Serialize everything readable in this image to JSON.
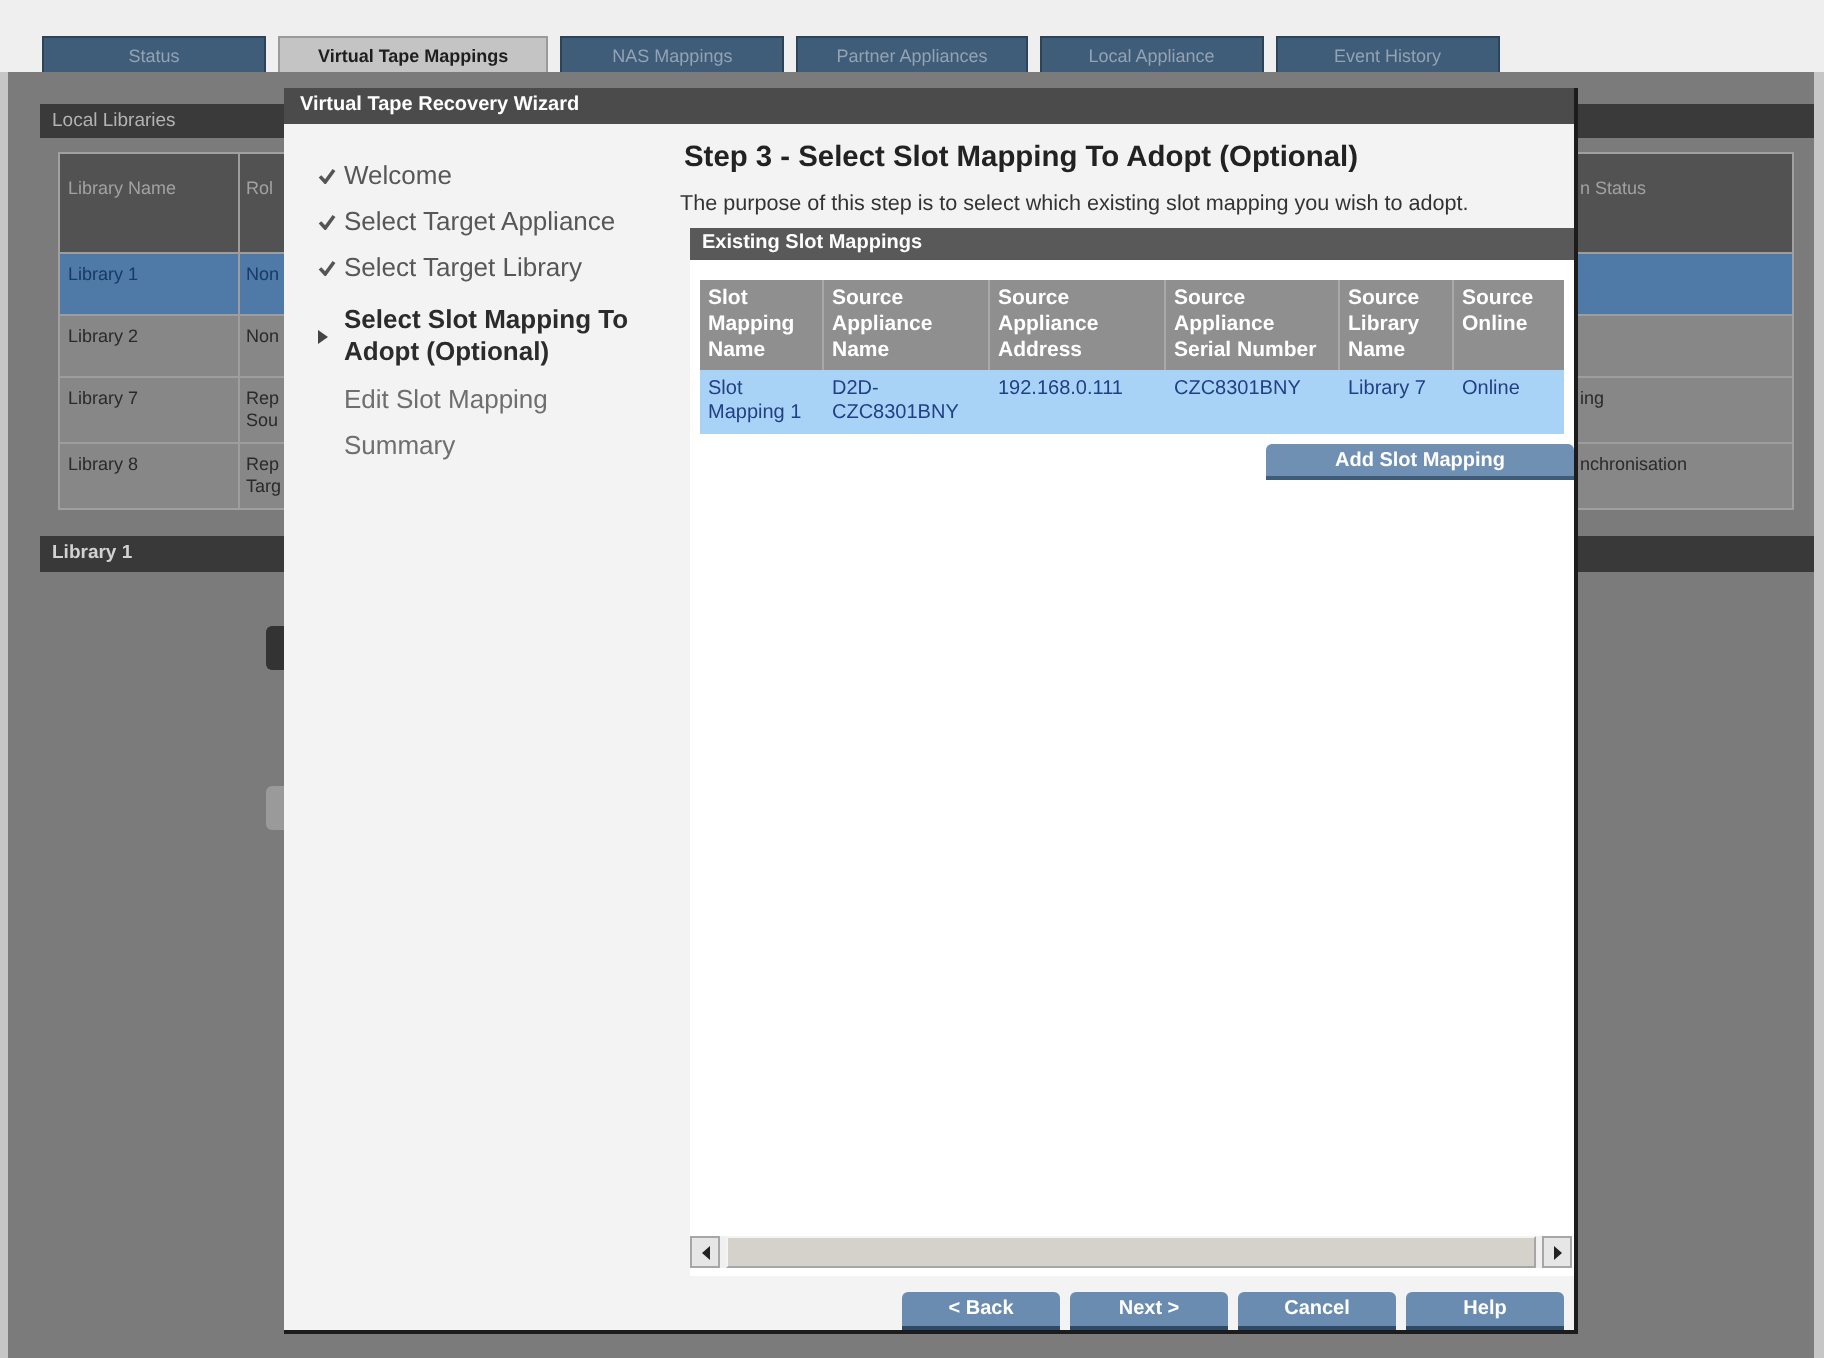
{
  "tabs": [
    {
      "label": "Status",
      "selected": false
    },
    {
      "label": "Virtual Tape Mappings",
      "selected": true
    },
    {
      "label": "NAS Mappings",
      "selected": false
    },
    {
      "label": "Partner Appliances",
      "selected": false
    },
    {
      "label": "Local Appliance",
      "selected": false
    },
    {
      "label": "Event History",
      "selected": false
    }
  ],
  "local_libraries": {
    "title": "Local Libraries",
    "columns": [
      "Library Name",
      "Rol",
      "n Status"
    ],
    "rows": [
      {
        "name": "Library 1",
        "role": [
          "Non"
        ],
        "selected": true
      },
      {
        "name": "Library 2",
        "role": [
          "Non"
        ],
        "selected": false
      },
      {
        "name": "Library 7",
        "role": [
          "Rep",
          "Sou"
        ],
        "status": "ing",
        "selected": false
      },
      {
        "name": "Library 8",
        "role": [
          "Rep",
          "Targ"
        ],
        "status": "nchronisation",
        "selected": false
      }
    ]
  },
  "library_detail": {
    "title": "Library 1"
  },
  "wizard": {
    "title": "Virtual Tape Recovery Wizard",
    "steps": [
      {
        "label": "Welcome",
        "done": true,
        "current": false
      },
      {
        "label": "Select Target Appliance",
        "done": true,
        "current": false
      },
      {
        "label": "Select Target Library",
        "done": true,
        "current": false
      },
      {
        "label": "Select Slot Mapping To Adopt (Optional)",
        "done": false,
        "current": true
      },
      {
        "label": "Edit Slot Mapping",
        "done": false,
        "current": false
      },
      {
        "label": "Summary",
        "done": false,
        "current": false
      }
    ],
    "heading": "Step 3 - Select Slot Mapping To Adopt (Optional)",
    "description": "The purpose of this step is to select which existing slot mapping you wish to adopt.",
    "slot_mappings": {
      "title": "Existing Slot Mappings",
      "columns": [
        "Slot Mapping Name",
        "Source Appliance Name",
        "Source Appliance Address",
        "Source Appliance Serial Number",
        "Source Library Name",
        "Source Online"
      ],
      "rows": [
        {
          "cells": [
            "Slot Mapping 1",
            "D2D-CZC8301BNY",
            "192.168.0.111",
            "CZC8301BNY",
            "Library 7",
            "Online"
          ],
          "selected": true
        }
      ],
      "add_button": "Add Slot Mapping"
    },
    "buttons": [
      "< Back",
      "Next >",
      "Cancel",
      "Help"
    ]
  }
}
